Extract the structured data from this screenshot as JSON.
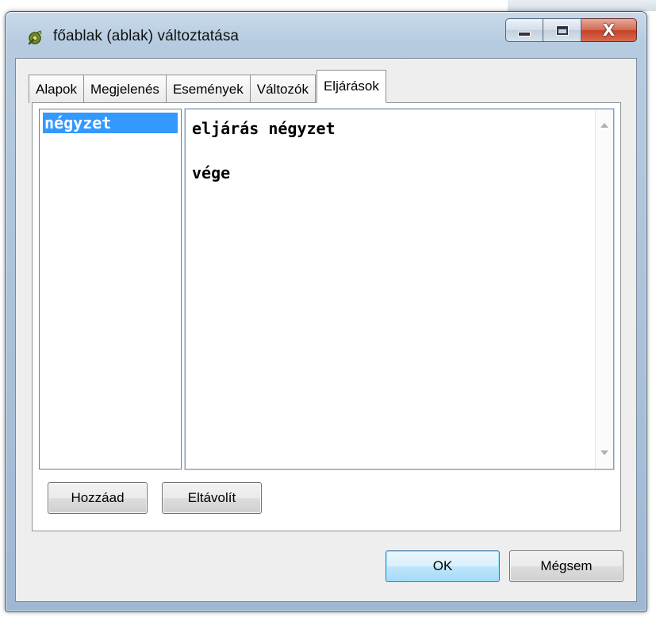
{
  "window": {
    "title": "főablak (ablak) változtatása",
    "controls": {
      "minimize": "minimize",
      "maximize": "maximize",
      "close": "X"
    }
  },
  "tabs": [
    {
      "label": "Alapok"
    },
    {
      "label": "Megjelenés"
    },
    {
      "label": "Események"
    },
    {
      "label": "Változók"
    },
    {
      "label": "Eljárások"
    }
  ],
  "active_tab": "Eljárások",
  "procedures": {
    "items": [
      {
        "label": "négyzet"
      }
    ],
    "selected": "négyzet"
  },
  "editor": {
    "lines": [
      "eljárás négyzet",
      "",
      "vége"
    ]
  },
  "buttons": {
    "add": "Hozzáad",
    "remove": "Eltávolít",
    "ok": "OK",
    "cancel": "Mégsem"
  },
  "colors": {
    "selection": "#3399ff",
    "window_frame": "#b6cbe0",
    "close_button": "#c5442a"
  },
  "icons": {
    "app": "gear-leaf-icon"
  }
}
